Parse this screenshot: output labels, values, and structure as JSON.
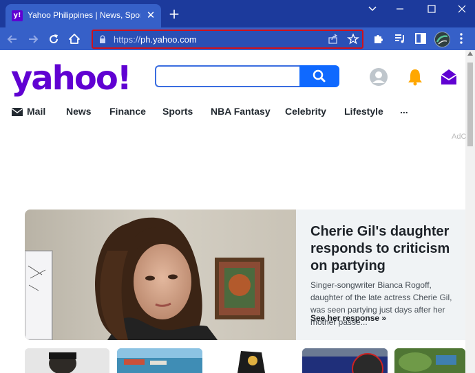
{
  "browser": {
    "tab_favicon": "y!",
    "tab_title": "Yahoo Philippines | News, Sports",
    "tab_close": "✕",
    "new_tab": "+",
    "url_scheme": "https://",
    "url_host": "ph.yahoo.com",
    "icons": [
      "back-icon",
      "forward-icon",
      "reload-icon",
      "home-icon",
      "lock-icon",
      "share-icon",
      "star-icon",
      "puzzle-icon",
      "media-queue-icon",
      "side-panel-icon",
      "profile-avatar",
      "kebab-menu-icon"
    ]
  },
  "header": {
    "logo": "yahoo!",
    "search_value": "",
    "icons": [
      "search-icon",
      "account-icon",
      "bell-icon",
      "mail-icon"
    ]
  },
  "nav": [
    "Mail",
    "News",
    "Finance",
    "Sports",
    "NBA Fantasy",
    "Celebrity",
    "Lifestyle",
    "..."
  ],
  "ad_label": "AdC",
  "hero": {
    "title": "Cherie Gil's daughter responds to criticism on partying",
    "summary": "Singer-songwriter Bianca Rogoff, daughter of the late actress Cherie Gil, was seen partying just days after her mother passe...",
    "link": "See her response »"
  },
  "colors": {
    "brand": "#6001d2",
    "titlebar": "#1c3a9c",
    "toolbar": "#3660c8",
    "search_button": "#0f69ff",
    "bell": "#ffa700",
    "highlight": "#d0101a"
  }
}
